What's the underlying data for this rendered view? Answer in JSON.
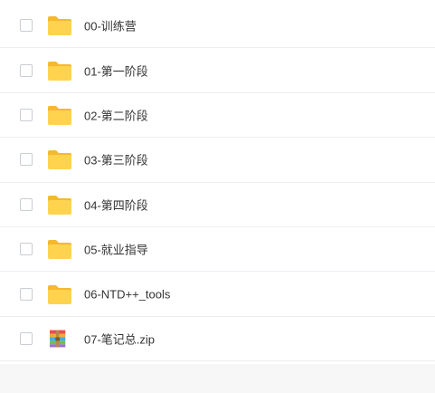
{
  "files": [
    {
      "name": "00-训练营",
      "type": "folder",
      "icon": "folder-icon"
    },
    {
      "name": "01-第一阶段",
      "type": "folder",
      "icon": "folder-icon"
    },
    {
      "name": "02-第二阶段",
      "type": "folder",
      "icon": "folder-icon"
    },
    {
      "name": "03-第三阶段",
      "type": "folder",
      "icon": "folder-icon"
    },
    {
      "name": "04-第四阶段",
      "type": "folder",
      "icon": "folder-icon"
    },
    {
      "name": "05-就业指导",
      "type": "folder",
      "icon": "folder-icon"
    },
    {
      "name": "06-NTD++_tools",
      "type": "folder",
      "icon": "folder-icon"
    },
    {
      "name": "07-笔记总.zip",
      "type": "zip",
      "icon": "zip-archive-icon"
    }
  ],
  "colors": {
    "folder_body": "#ffd34e",
    "folder_back": "#f4b92e",
    "divider": "#eceef2",
    "text": "#333333"
  }
}
